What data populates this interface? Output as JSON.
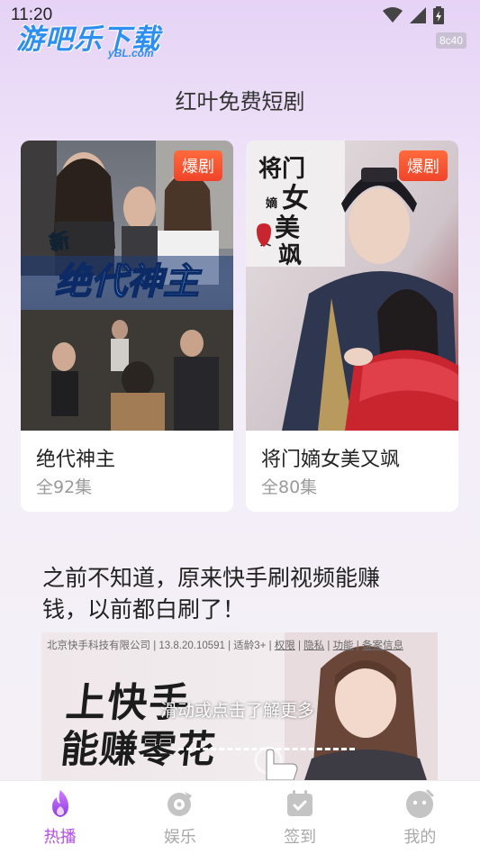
{
  "status_bar": {
    "time": "11:20"
  },
  "watermark": {
    "logo_text": "游吧乐下载",
    "logo_sub": "yBL.com",
    "code": "8c40"
  },
  "page": {
    "title": "红叶免费短剧"
  },
  "dramas": [
    {
      "title": "绝代神主",
      "episodes": "全92集",
      "badge": "爆剧",
      "poster_text": "绝代神主",
      "poster_tag": "新"
    },
    {
      "title": "将门嫡女美又飒",
      "episodes": "全80集",
      "badge": "爆剧",
      "poster_text": "将门嫡女美又飒"
    }
  ],
  "ad": {
    "headline": "之前不知道，原来快手刷视频能赚钱，以前都白刷了！",
    "topline_prefix": "北京快手科技有限公司 | 13.8.20.10591 | 适龄3+ | ",
    "topline_links": [
      "权限",
      "隐私",
      "功能",
      "备案信息"
    ],
    "big_line1": "上快手",
    "big_line2": "能赚零花",
    "overlay": "滑动或点击了解更多"
  },
  "nav": [
    {
      "label": "热播",
      "icon": "flame-icon",
      "active": true
    },
    {
      "label": "娱乐",
      "icon": "disc-icon",
      "active": false
    },
    {
      "label": "签到",
      "icon": "calendar-check-icon",
      "active": false
    },
    {
      "label": "我的",
      "icon": "profile-icon",
      "active": false
    }
  ],
  "colors": {
    "accent": "#b44ee8",
    "badge": "#f0442a",
    "logo_blue": "#2f8ff0"
  }
}
